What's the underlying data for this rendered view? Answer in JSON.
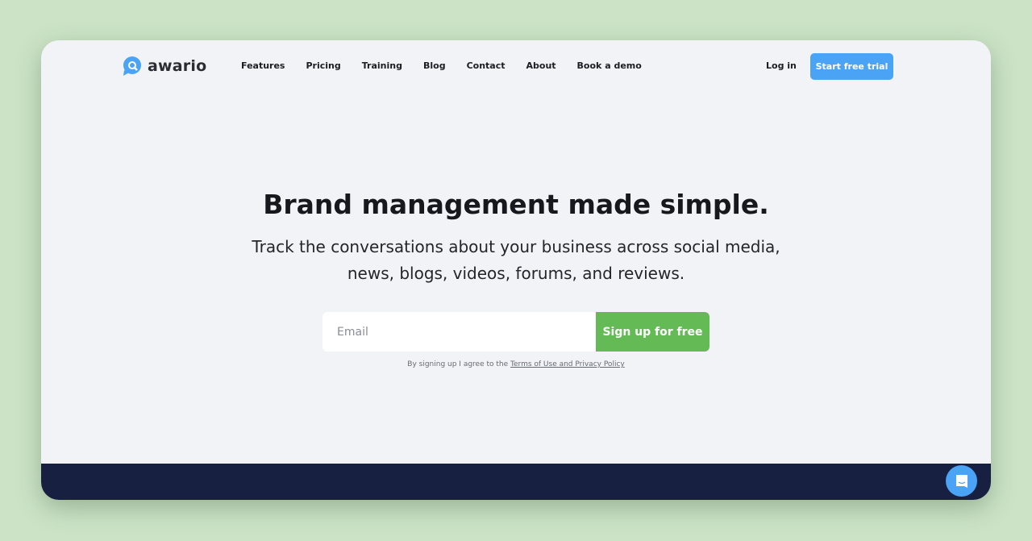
{
  "brand": {
    "name": "awario",
    "accent": "#4aa3f5",
    "green": "#64bb55"
  },
  "nav": {
    "links": [
      "Features",
      "Pricing",
      "Training",
      "Blog",
      "Contact",
      "About",
      "Book a demo"
    ],
    "login": "Log in",
    "cta": "Start free trial"
  },
  "hero": {
    "title": "Brand management made simple.",
    "subtitle_line1": "Track the conversations about your business across social media,",
    "subtitle_line2": "news, blogs, videos, forums, and reviews.",
    "email_placeholder": "Email",
    "signup": "Sign up for free",
    "terms_prefix": "By signing up I agree to the ",
    "terms_link": "Terms of Use and Privacy Policy"
  },
  "chat": {
    "icon": "chat-icon"
  }
}
